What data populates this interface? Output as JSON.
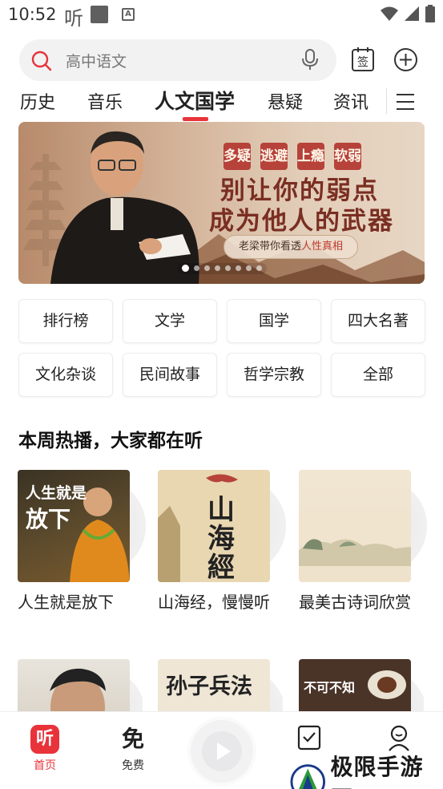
{
  "status": {
    "time": "10:52",
    "app_glyph": "听"
  },
  "search": {
    "placeholder": "高中语文"
  },
  "tabs": [
    {
      "label": "历史"
    },
    {
      "label": "音乐"
    },
    {
      "label": "人文国学",
      "active": true
    },
    {
      "label": "悬疑"
    },
    {
      "label": "资讯"
    }
  ],
  "banner": {
    "tags": [
      "多疑",
      "逃避",
      "上瘾",
      "软弱"
    ],
    "line1": "别让你的弱点",
    "line2": "成为他人的武器",
    "sub_prefix": "老梁带你看透",
    "sub_highlight": "人性真相",
    "dots_total": 8,
    "dots_active_index": 0
  },
  "categories": [
    {
      "label": "排行榜"
    },
    {
      "label": "文学"
    },
    {
      "label": "国学"
    },
    {
      "label": "四大名著"
    },
    {
      "label": "文化杂谈"
    },
    {
      "label": "民间故事"
    },
    {
      "label": "哲学宗教"
    },
    {
      "label": "全部"
    }
  ],
  "section": {
    "title": "本周热播，大家都在听"
  },
  "cards": [
    {
      "title": "人生就是放下",
      "cover_text_1": "人生就是",
      "cover_text_2": "放下"
    },
    {
      "title": "山海经，慢慢听",
      "cover_text_1": "山",
      "cover_text_2": "海",
      "cover_text_3": "經"
    },
    {
      "title": "最美古诗词欣赏"
    }
  ],
  "cards_row2": [
    {
      "cover_text": ""
    },
    {
      "cover_text": "孙子兵法"
    },
    {
      "cover_text": "不可不知"
    }
  ],
  "bottom_nav": {
    "home": {
      "label": "首页",
      "glyph": "听"
    },
    "free": {
      "label": "免费",
      "glyph": "免"
    }
  },
  "watermark": {
    "text": "极限手游网"
  },
  "colors": {
    "accent": "#e8333b",
    "banner_red": "#b6423a"
  }
}
